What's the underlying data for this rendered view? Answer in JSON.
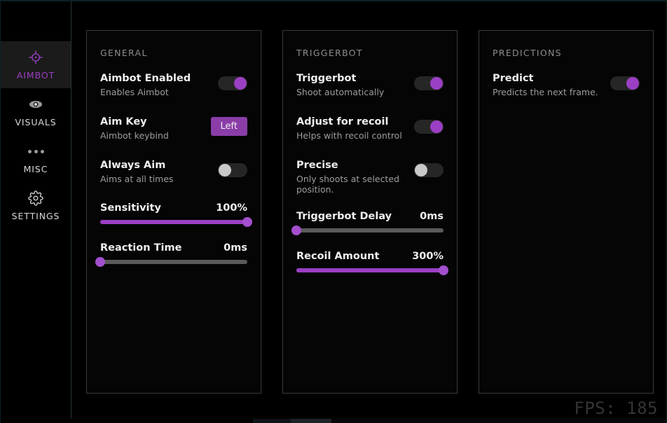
{
  "theme": {
    "accent": "#9b3fc4",
    "accent_badge": "#8a3da8",
    "background": "#000000",
    "panel_border": "#393939",
    "text_primary": "#efefef",
    "text_secondary": "#9d9d9d",
    "track_off": "#5a5a5a"
  },
  "sidebar": {
    "items": [
      {
        "label": "AIMBOT",
        "icon": "crosshair-icon",
        "active": true
      },
      {
        "label": "VISUALS",
        "icon": "eye-icon",
        "active": false
      },
      {
        "label": "MISC",
        "icon": "dots-icon",
        "active": false
      },
      {
        "label": "SETTINGS",
        "icon": "gear-icon",
        "active": false
      }
    ]
  },
  "panels": [
    {
      "title": "GENERAL",
      "rows": [
        {
          "title": "Aimbot Enabled",
          "desc": "Enables Aimbot",
          "control": "toggle",
          "state": "on"
        },
        {
          "title": "Aim Key",
          "desc": "Aimbot keybind",
          "control": "keybind",
          "value": "Left"
        },
        {
          "title": "Always Aim",
          "desc": "Aims at all times",
          "control": "toggle",
          "state": "off"
        }
      ],
      "sliders": [
        {
          "name": "Sensitivity",
          "value": "100%",
          "percent": 100
        },
        {
          "name": "Reaction Time",
          "value": "0ms",
          "percent": 0
        }
      ]
    },
    {
      "title": "TRIGGERBOT",
      "rows": [
        {
          "title": "Triggerbot",
          "desc": "Shoot automatically",
          "control": "toggle",
          "state": "on"
        },
        {
          "title": "Adjust for recoil",
          "desc": "Helps with recoil control",
          "control": "toggle",
          "state": "on"
        },
        {
          "title": "Precise",
          "desc": "Only shoots at selected position.",
          "control": "toggle",
          "state": "off"
        }
      ],
      "sliders": [
        {
          "name": "Triggerbot Delay",
          "value": "0ms",
          "percent": 0
        },
        {
          "name": "Recoil Amount",
          "value": "300%",
          "percent": 100
        }
      ]
    },
    {
      "title": "PREDICTIONS",
      "rows": [
        {
          "title": "Predict",
          "desc": "Predicts the next frame.",
          "control": "toggle",
          "state": "on"
        }
      ],
      "sliders": []
    }
  ],
  "overlay": {
    "fps_label": "FPS: 185"
  }
}
